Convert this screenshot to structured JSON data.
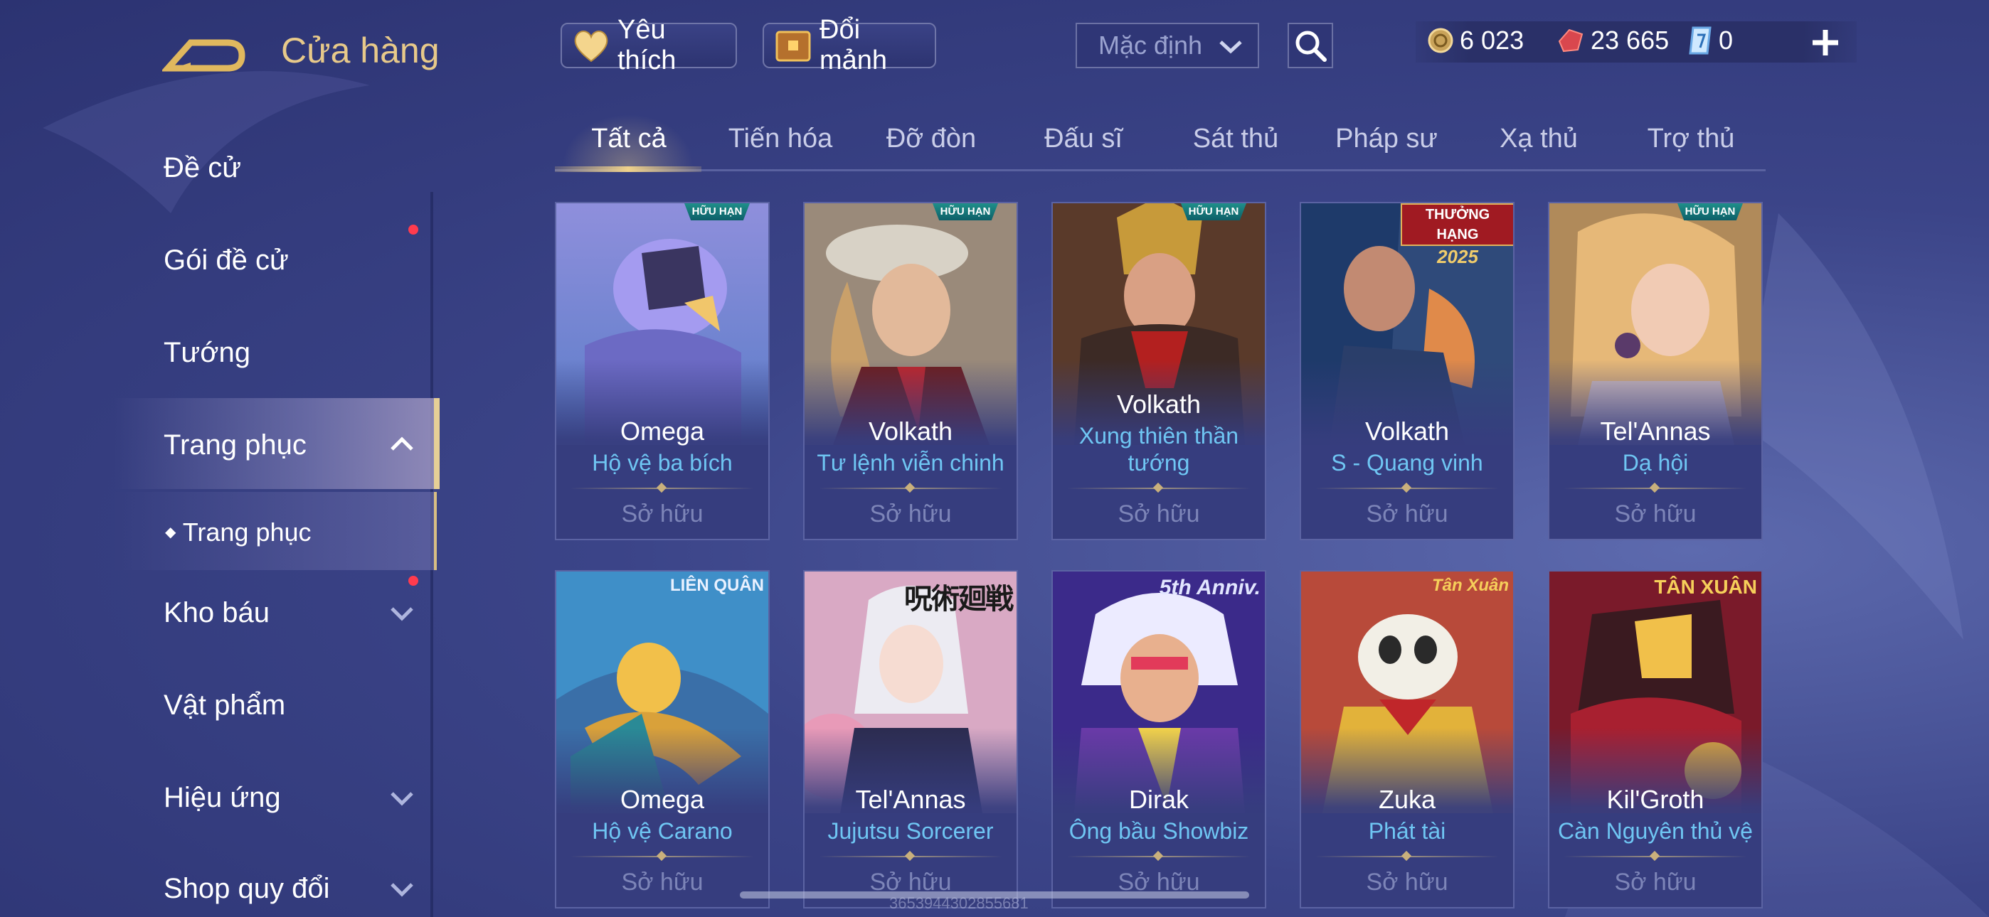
{
  "header": {
    "title": "Cửa hàng",
    "favorite_label": "Yêu thích",
    "shard_label": "Đổi mảnh",
    "sort": {
      "selected": "Mặc định"
    }
  },
  "currencies": {
    "gold": "6 023",
    "vouchers": "23 665",
    "quan_huy": "0"
  },
  "sidebar": {
    "items": [
      {
        "label": "Đề cử"
      },
      {
        "label": "Gói đề cử"
      },
      {
        "label": "Tướng"
      },
      {
        "label": "Trang phục"
      },
      {
        "label": "Trang phục"
      },
      {
        "label": "Kho báu"
      },
      {
        "label": "Vật phẩm"
      },
      {
        "label": "Hiệu ứng"
      },
      {
        "label": "Shop quy đổi"
      }
    ]
  },
  "tabs": [
    "Tất cả",
    "Tiến hóa",
    "Đỡ đòn",
    "Đấu sĩ",
    "Sát thủ",
    "Pháp sư",
    "Xạ thủ",
    "Trợ thủ"
  ],
  "cards": [
    {
      "hero": "Omega",
      "skin": "Hộ vệ ba bích",
      "status": "Sở hữu",
      "badge": "HỮU HẠN"
    },
    {
      "hero": "Volkath",
      "skin": "Tư lệnh viễn chinh",
      "status": "Sở hữu",
      "badge": "HỮU HẠN"
    },
    {
      "hero": "Volkath",
      "skin": "Xung thiên thần tướng",
      "skin_l1": "Xung thiên thần",
      "skin_l2": "tướng",
      "status": "Sở hữu",
      "badge": "HỮU HẠN"
    },
    {
      "hero": "Volkath",
      "skin": "S - Quang vinh",
      "status": "Sở hữu",
      "badge": "THƯỞNG HẠNG",
      "badge2": "2025"
    },
    {
      "hero": "Tel'Annas",
      "skin": "Dạ hội",
      "status": "Sở hữu",
      "badge": "HỮU HẠN"
    },
    {
      "hero": "Omega",
      "skin": "Hộ vệ Carano",
      "status": "Sở hữu",
      "logo": "LIÊN QUÂN"
    },
    {
      "hero": "Tel'Annas",
      "skin": "Jujutsu Sorcerer",
      "status": "Sở hữu",
      "logo": "呪術廻戦"
    },
    {
      "hero": "Dirak",
      "skin": "Ông bầu Showbiz",
      "status": "Sở hữu",
      "logo": "5th Anniv."
    },
    {
      "hero": "Zuka",
      "skin": "Phát tài",
      "status": "Sở hữu",
      "logo": "Tân Xuân"
    },
    {
      "hero": "Kil'Groth",
      "skin": "Càn Nguyên thủ vệ",
      "status": "Sở hữu",
      "logo": "TÂN XUÂN"
    }
  ],
  "watermark": "3653944302855681",
  "colors": {
    "accent_gold": "#e7c98a",
    "skin_name": "#6fc6f3",
    "notification": "#ff3b4e"
  }
}
